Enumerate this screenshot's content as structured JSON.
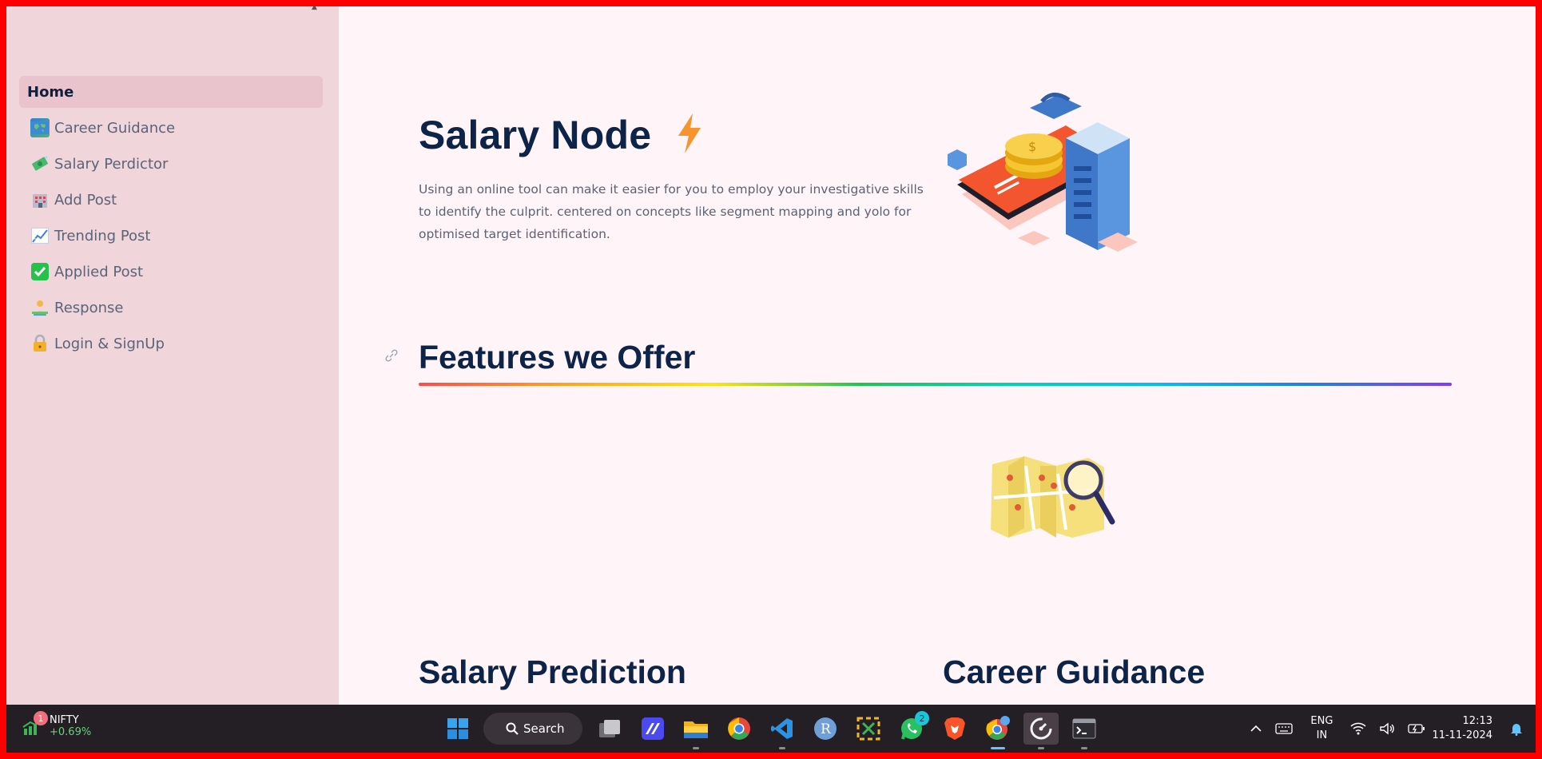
{
  "sidebar": {
    "items": [
      {
        "label": "Home",
        "icon": "",
        "active": true
      },
      {
        "label": "Career Guidance",
        "icon": "world-map-icon"
      },
      {
        "label": "Salary Perdictor",
        "icon": "money-icon"
      },
      {
        "label": "Add Post",
        "icon": "hotel-icon"
      },
      {
        "label": "Trending Post",
        "icon": "chart-increasing-icon"
      },
      {
        "label": "Applied Post",
        "icon": "check-mark-icon"
      },
      {
        "label": "Response",
        "icon": "person-icon"
      },
      {
        "label": "Login & SignUp",
        "icon": "lock-icon"
      }
    ]
  },
  "main": {
    "title": "Salary Node",
    "intro": "Using an online tool can make it easier for you to employ your investigative skills to identify the culprit. centered on concepts like segment mapping and yolo for optimised target identification.",
    "features_title": "Features we Offer",
    "features": [
      {
        "title": "Salary Prediction"
      },
      {
        "title": "Career Guidance"
      }
    ]
  },
  "taskbar": {
    "nifty_name": "NIFTY",
    "nifty_change": "+0.69%",
    "nifty_badge": "1",
    "search_label": "Search",
    "whatsapp_badge": "2",
    "lang_line1": "ENG",
    "lang_line2": "IN",
    "time": "12:13",
    "date": "11-11-2024"
  },
  "colors": {
    "frame_border": "#ff0000",
    "sidebar_bg": "#f0d5da",
    "main_bg": "#fff5f8",
    "heading": "#0d2347",
    "taskbar_bg": "#231f24"
  }
}
